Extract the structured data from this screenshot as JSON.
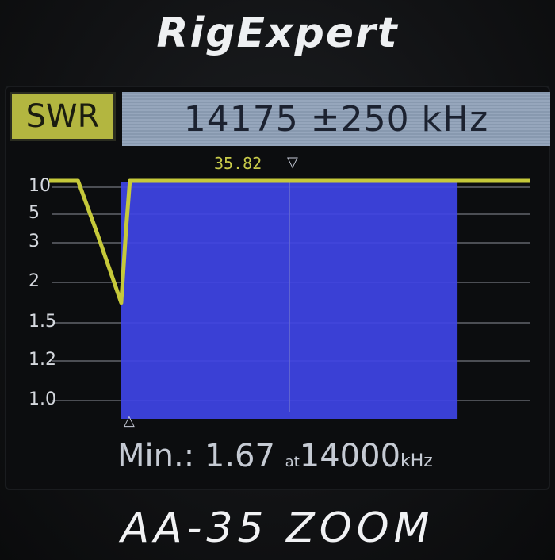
{
  "brand": "RigExpert",
  "header": {
    "mode": "SWR",
    "range": "14175 ±250 kHz"
  },
  "marker": {
    "value": "35.82",
    "top_glyph": "▽",
    "bottom_glyph": "△"
  },
  "min_readout": {
    "prefix": "Min.:",
    "value": "1.67",
    "at": "at",
    "freq": "14000",
    "unit": "kHz"
  },
  "model": "AA-35 ZOOM",
  "colors": {
    "trace": "#c6c93a",
    "band": "#3f44e6",
    "header_mode_bg": "#b3b640",
    "header_range_bg": "#8fa1b8"
  },
  "chart_data": {
    "type": "line",
    "y_scale": "swr-log",
    "y_ticks": [
      "10",
      "5",
      "3",
      "2",
      "1.5",
      "1.2",
      "1.0"
    ],
    "x_range_khz": [
      13925,
      14425
    ],
    "band_khz": [
      14000,
      14350
    ],
    "series": [
      {
        "x": [
          13925,
          13955,
          13975,
          14000,
          14005,
          14009,
          14030,
          14100,
          14200,
          14300,
          14425
        ],
        "y": [
          10,
          10,
          3.2,
          1.67,
          3.5,
          10,
          10,
          10,
          10,
          10,
          10
        ]
      }
    ],
    "grid": true
  }
}
